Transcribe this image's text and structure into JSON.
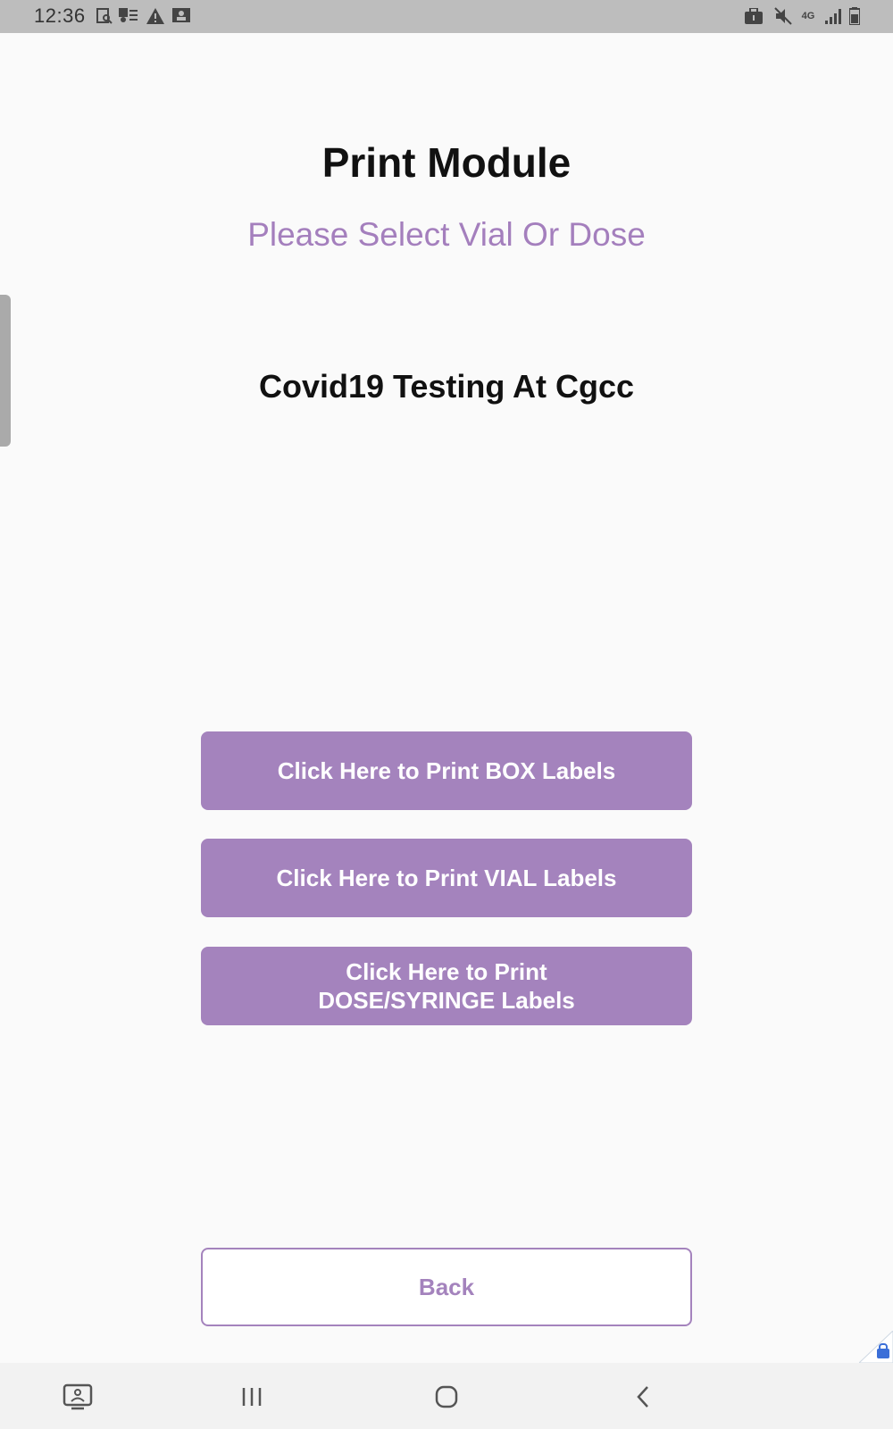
{
  "status_bar": {
    "time": "12:36",
    "left_icons": [
      "screen-search-icon",
      "contacts-icon",
      "warning-icon",
      "screen-share-icon"
    ],
    "right_icons": [
      "work-profile-icon",
      "mute-icon",
      "4g-lte-icon",
      "signal-icon",
      "battery-icon"
    ]
  },
  "page": {
    "title": "Print Module",
    "subtitle": "Please Select Vial Or Dose",
    "org_name": "Covid19 Testing At Cgcc"
  },
  "buttons": {
    "box_label": "Click Here to Print BOX Labels",
    "vial_label": "Click Here to Print VIAL Labels",
    "dose_label_line1": "Click Here to Print",
    "dose_label_line2": "DOSE/SYRINGE Labels",
    "back_label": "Back"
  },
  "nav_bar": {
    "items": [
      "screenshot-icon",
      "recents-icon",
      "home-icon",
      "back-icon"
    ]
  },
  "colors": {
    "accent": "#a483bd",
    "status_bar": "#bdbdbd",
    "background": "#fafafa"
  }
}
